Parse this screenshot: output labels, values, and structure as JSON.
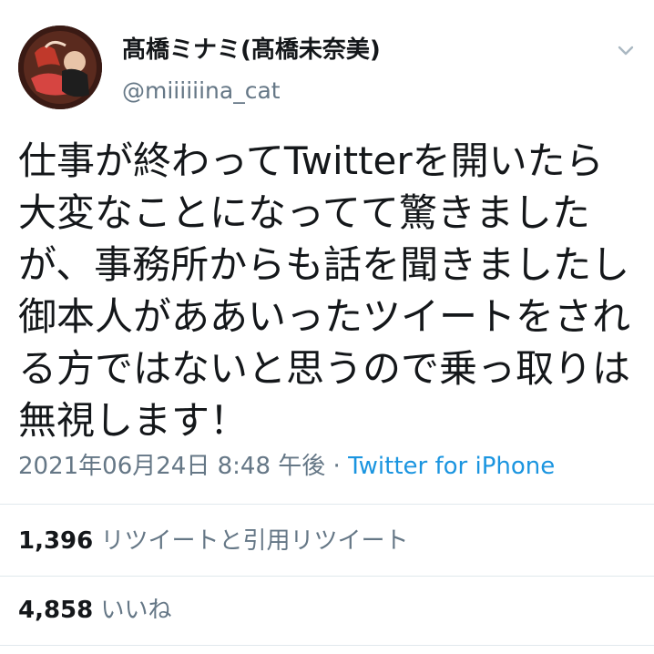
{
  "tweet": {
    "display_name": "髙橋ミナミ(髙橋未奈美)",
    "handle": "@miiiiiina_cat",
    "text_lines": [
      "仕事が終わってTwitterを開いたら",
      "大変なことになってて驚きました",
      "が、事務所からも話を聞きましたし",
      "御本人がああいったツイートをされ",
      "る方ではないと思うので乗っ取りは",
      "無視します！"
    ],
    "timestamp": "2021年06月24日 8:48 午後",
    "separator": " · ",
    "source": "Twitter for iPhone"
  },
  "stats": {
    "retweets_count": "1,396",
    "retweets_label": "リツイートと引用リツイート",
    "likes_count": "4,858",
    "likes_label": "いいね"
  },
  "icons": {
    "menu": "chevron-down-icon",
    "avatar": "avatar"
  },
  "colors": {
    "text": "#14171a",
    "secondary": "#657786",
    "link": "#1b95e0",
    "divider": "#e1e8ed"
  }
}
